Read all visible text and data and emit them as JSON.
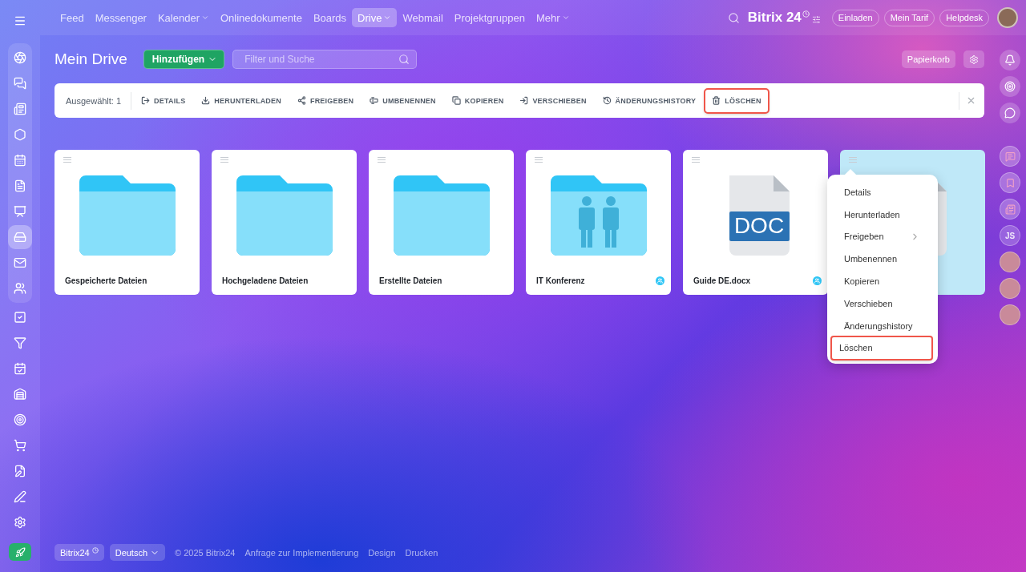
{
  "sidebar": {
    "items": [
      {
        "selected": false
      },
      {
        "selected": false
      },
      {
        "selected": false
      },
      {
        "selected": false
      },
      {
        "selected": false
      },
      {
        "selected": false
      },
      {
        "selected": false
      },
      {
        "selected": true
      },
      {
        "selected": false
      },
      {
        "selected": false
      }
    ]
  },
  "topnav": {
    "items": [
      {
        "label": "Feed",
        "selected": false,
        "dropdown": false
      },
      {
        "label": "Messenger",
        "selected": false,
        "dropdown": false
      },
      {
        "label": "Kalender",
        "selected": false,
        "dropdown": true
      },
      {
        "label": "Onlinedokumente",
        "selected": false,
        "dropdown": false
      },
      {
        "label": "Boards",
        "selected": false,
        "dropdown": false
      },
      {
        "label": "Drive",
        "selected": true,
        "dropdown": true
      },
      {
        "label": "Webmail",
        "selected": false,
        "dropdown": false
      },
      {
        "label": "Projektgruppen",
        "selected": false,
        "dropdown": false
      },
      {
        "label": "Mehr",
        "selected": false,
        "dropdown": true
      }
    ],
    "brand": "Bitrix 24",
    "buttons": [
      "Einladen",
      "Mein Tarif",
      "Helpdesk"
    ]
  },
  "header": {
    "title": "Mein Drive",
    "add_button": "Hinzufügen",
    "search": {
      "placeholder": "Filter und Suche"
    },
    "trash_button": "Papierkorb"
  },
  "action_bar": {
    "selection": "Ausgewählt: 1",
    "actions": [
      {
        "kind": "details",
        "label": "DETAILS",
        "highlighted": false
      },
      {
        "kind": "download",
        "label": "HERUNTERLADEN",
        "highlighted": false
      },
      {
        "kind": "share",
        "label": "FREIGEBEN",
        "highlighted": false
      },
      {
        "kind": "rename",
        "label": "UMBENENNEN",
        "highlighted": false
      },
      {
        "kind": "copy",
        "label": "KOPIEREN",
        "highlighted": false
      },
      {
        "kind": "move",
        "label": "VERSCHIEBEN",
        "highlighted": false
      },
      {
        "kind": "history",
        "label": "ÄNDERUNGSHISTORY",
        "highlighted": false
      },
      {
        "kind": "delete",
        "label": "LÖSCHEN",
        "highlighted": true
      }
    ]
  },
  "files": [
    {
      "kind": "folder",
      "name": "Gespeicherte Dateien",
      "shared": false,
      "selected": false
    },
    {
      "kind": "folder",
      "name": "Hochgeladene Dateien",
      "shared": false,
      "selected": false
    },
    {
      "kind": "folder",
      "name": "Erstellte Dateien",
      "shared": false,
      "selected": false
    },
    {
      "kind": "shared-folder",
      "name": "IT Konferenz",
      "shared": true,
      "selected": false
    },
    {
      "kind": "doc",
      "name": "Guide DE.docx",
      "doc_label": "DOC",
      "shared": true,
      "selected": false
    },
    {
      "kind": "doc",
      "selected": true
    }
  ],
  "context_menu": {
    "items": [
      {
        "label": "Details",
        "submenu": false,
        "highlighted": false
      },
      {
        "label": "Herunterladen",
        "submenu": false,
        "highlighted": false
      },
      {
        "label": "Freigeben",
        "submenu": true,
        "highlighted": false
      },
      {
        "label": "Umbenennen",
        "submenu": false,
        "highlighted": false
      },
      {
        "label": "Kopieren",
        "submenu": false,
        "highlighted": false
      },
      {
        "label": "Verschieben",
        "submenu": false,
        "highlighted": false
      },
      {
        "label": "Änderungshistory",
        "submenu": false,
        "highlighted": false
      },
      {
        "label": "Löschen",
        "submenu": false,
        "highlighted": true
      }
    ]
  },
  "right_rail": {
    "avatars": [
      {
        "kind": "icon"
      },
      {
        "kind": "icon"
      },
      {
        "kind": "icon"
      },
      {
        "kind": "initials",
        "text": "JS"
      },
      {
        "kind": "photo"
      },
      {
        "kind": "photo"
      },
      {
        "kind": "photo"
      }
    ]
  },
  "footer": {
    "brand": "Bitrix24",
    "language": "Deutsch",
    "links": [
      "© 2025 Bitrix24",
      "Anfrage zur Implementierung",
      "Design",
      "Drucken"
    ]
  }
}
